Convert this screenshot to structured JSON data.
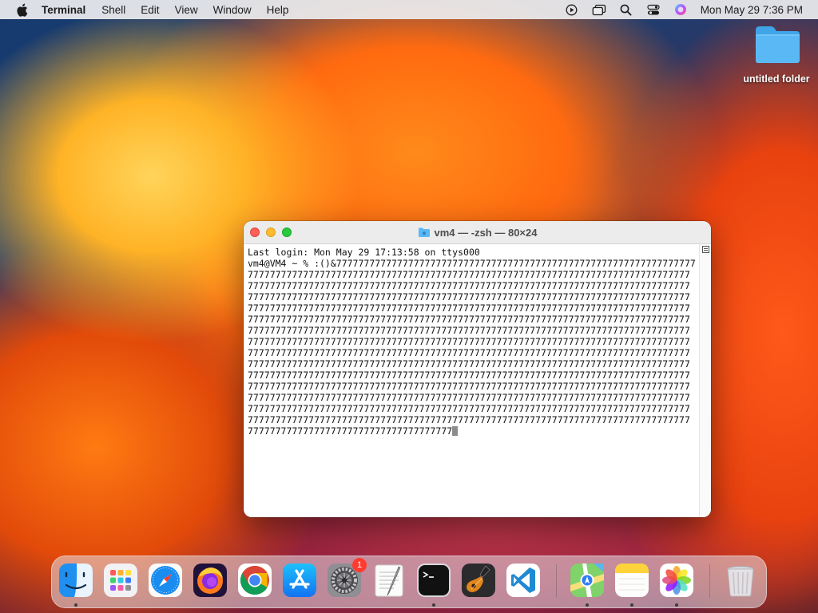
{
  "menubar": {
    "app_name": "Terminal",
    "menus": [
      "Shell",
      "Edit",
      "View",
      "Window",
      "Help"
    ],
    "clock": "Mon May 29  7:36 PM",
    "status_icons": [
      "play-circle-icon",
      "screen-mirroring-icon",
      "search-icon",
      "control-center-icon",
      "siri-icon"
    ]
  },
  "desktop": {
    "folder_label": "untitled folder",
    "folder_color": "#5ab8f5"
  },
  "window": {
    "title": "vm4 — -zsh — 80×24",
    "terminal": {
      "line1": "Last login: Mon May 29 17:13:58 on ttys000",
      "line2": "vm4@VM4 ~ % :()&77777777777777777777777777777777777777777777777777777777777777777",
      "fill_lines": [
        "77777777777777777777777777777777777777777777777777777777777777777777777777777777",
        "77777777777777777777777777777777777777777777777777777777777777777777777777777777",
        "77777777777777777777777777777777777777777777777777777777777777777777777777777777",
        "77777777777777777777777777777777777777777777777777777777777777777777777777777777",
        "77777777777777777777777777777777777777777777777777777777777777777777777777777777",
        "77777777777777777777777777777777777777777777777777777777777777777777777777777777",
        "77777777777777777777777777777777777777777777777777777777777777777777777777777777",
        "77777777777777777777777777777777777777777777777777777777777777777777777777777777",
        "77777777777777777777777777777777777777777777777777777777777777777777777777777777",
        "77777777777777777777777777777777777777777777777777777777777777777777777777777777",
        "77777777777777777777777777777777777777777777777777777777777777777777777777777777",
        "77777777777777777777777777777777777777777777777777777777777777777777777777777777",
        "77777777777777777777777777777777777777777777777777777777777777777777777777777777",
        "77777777777777777777777777777777777777777777777777777777777777777777777777777777"
      ],
      "last_line": "7777777777777777777777777777777777777"
    }
  },
  "dock": {
    "apps": [
      {
        "name": "Finder",
        "icon": "finder-icon",
        "running": true
      },
      {
        "name": "Launchpad",
        "icon": "launchpad-icon",
        "running": false
      },
      {
        "name": "Safari",
        "icon": "safari-icon",
        "running": false
      },
      {
        "name": "Firefox",
        "icon": "firefox-icon",
        "running": false
      },
      {
        "name": "Google Chrome",
        "icon": "chrome-icon",
        "running": false
      },
      {
        "name": "App Store",
        "icon": "app-store-icon",
        "running": false
      },
      {
        "name": "System Settings",
        "icon": "system-settings-icon",
        "running": false,
        "badge": "1"
      },
      {
        "name": "TextEdit",
        "icon": "textedit-icon",
        "running": false
      },
      {
        "name": "Terminal",
        "icon": "terminal-icon",
        "running": true
      },
      {
        "name": "GarageBand",
        "icon": "garageband-icon",
        "running": false
      },
      {
        "name": "Visual Studio Code",
        "icon": "vscode-icon",
        "running": false
      },
      {
        "name": "Maps",
        "icon": "maps-icon",
        "running": true
      },
      {
        "name": "Notes",
        "icon": "notes-icon",
        "running": true
      },
      {
        "name": "Photos",
        "icon": "photos-icon",
        "running": true
      },
      {
        "name": "Trash",
        "icon": "trash-icon",
        "running": false
      }
    ]
  }
}
